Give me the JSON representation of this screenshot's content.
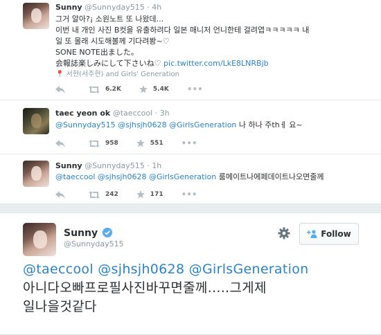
{
  "tweets": [
    {
      "name": "Sunny",
      "handle": "@Sunnyday515",
      "time": "· 4h",
      "lines": [
        "그거 알아?¡ 소원노트 또 나왔데...",
        "이번 내 개인 사진 B컷을 유출하려다 일본 매니저 언니한테 걸려엽ㅋㅋㅋㅋㅋ 내",
        "일 또 몰래 시도해볼께 기다려봥~♡",
        "SONE NOTE出ました。",
        "会報誌楽しみにして下さいね♡"
      ],
      "pic_link": "pic.twitter.com/LkE8LNRBjb",
      "context": "서현(서주현) and Girls' Generation",
      "retweets": "6.2K",
      "favorites": "5.4K"
    },
    {
      "name": "taec yeon ok",
      "handle": "@taeccool",
      "time": "· 3h",
      "mentions": "@Sunnyday515 @sjhsjh0628 @GirlsGeneration",
      "text": " 나 하나 주thㅔ 요~",
      "retweets": "958",
      "favorites": "551"
    },
    {
      "name": "Sunny",
      "handle": "@Sunnyday515",
      "time": "· 1h",
      "mentions": "@taeccool @sjhsjh0628 @GirlsGeneration",
      "text": " 룸메이트나에페데이트나오면줄께",
      "retweets": "242",
      "favorites": "171"
    }
  ],
  "featured": {
    "name": "Sunny",
    "handle": "@Sunnyday515",
    "follow_label": "Follow",
    "mentions": "@taeccool @sjhsjh0628 @GirlsGeneration",
    "line1": "아니다오빠프로필사진바꾸면줄께.....그게제",
    "line2": "일나을것같다"
  },
  "colors": {
    "link": "#2a83c8",
    "verified": "#55acee",
    "muted": "#8899a6"
  }
}
